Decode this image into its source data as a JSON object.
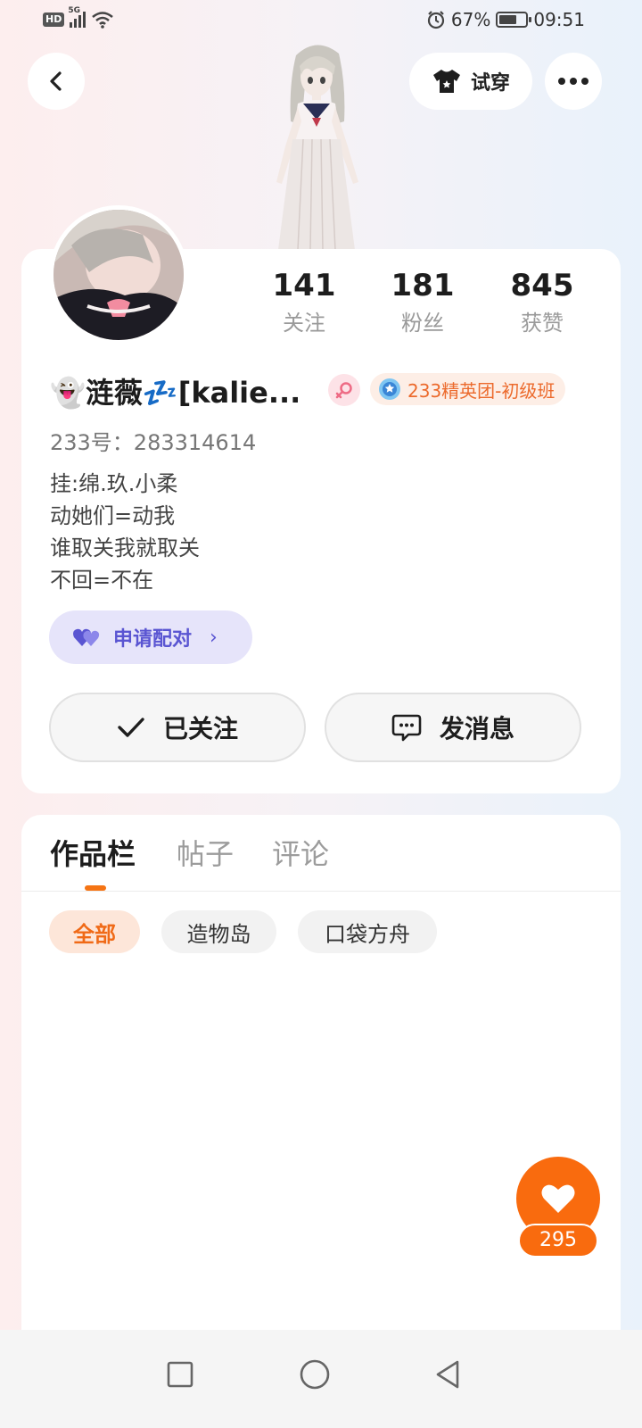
{
  "status_bar": {
    "hd": "HD",
    "network": "5G",
    "battery": "67%",
    "battery_level": 0.67,
    "time": "09:51"
  },
  "header": {
    "try_on_label": "试穿"
  },
  "stats": [
    {
      "value": "141",
      "label": "关注"
    },
    {
      "value": "181",
      "label": "粉丝"
    },
    {
      "value": "845",
      "label": "获赞"
    }
  ],
  "profile": {
    "name": "👻涟薇💤[kalie...",
    "gender": "female",
    "rank_badge": "233精英团-初级班",
    "uid_line": "233号：283314614",
    "bio": [
      "挂:绵.玖.小柔",
      "动她们=动我",
      "谁取关我就取关",
      "不回=不在"
    ],
    "pair_button": "申请配对",
    "follow_button": "已关注",
    "message_button": "发消息"
  },
  "works": {
    "tabs": [
      "作品栏",
      "帖子",
      "评论"
    ],
    "active_tab": 0,
    "filters": [
      "全部",
      "造物岛",
      "口袋方舟"
    ],
    "active_filter": 0
  },
  "like": {
    "count": "295"
  },
  "colors": {
    "accent": "#f96b0e",
    "pair": "#5a55d2",
    "rank": "#ec6a2c"
  }
}
